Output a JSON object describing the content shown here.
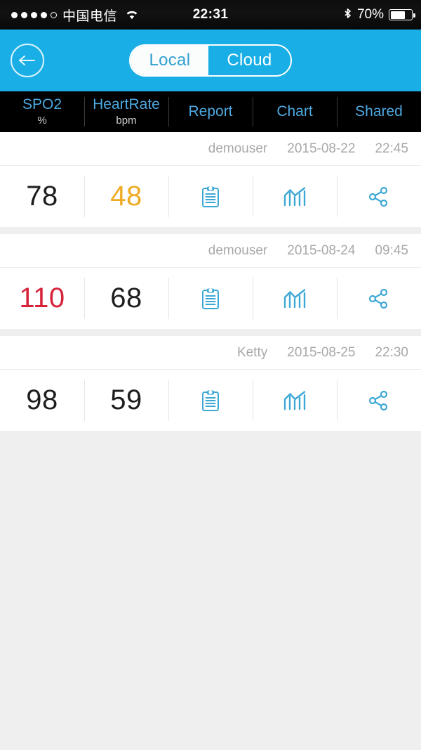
{
  "status_bar": {
    "signal_dots_filled": 4,
    "signal_dots_total": 5,
    "carrier": "中国电信",
    "wifi_icon": "wifi-icon",
    "time": "22:31",
    "bluetooth_icon": "bluetooth-icon",
    "battery_percent": "70%",
    "battery_level": 70
  },
  "nav_bar": {
    "back_icon": "back-arrow-icon",
    "segments": [
      {
        "label": "Local",
        "selected": true
      },
      {
        "label": "Cloud",
        "selected": false
      }
    ]
  },
  "columns": [
    {
      "title": "SPO2",
      "unit": "%"
    },
    {
      "title": "HeartRate",
      "unit": "bpm"
    },
    {
      "title": "Report",
      "unit": ""
    },
    {
      "title": "Chart",
      "unit": ""
    },
    {
      "title": "Shared",
      "unit": ""
    }
  ],
  "records": [
    {
      "user": "demouser",
      "date": "2015-08-22",
      "time": "22:45",
      "spo2": "78",
      "spo2_state": "normal",
      "heart_rate": "48",
      "heart_rate_state": "warn",
      "report_icon": "clipboard-report-icon",
      "chart_icon": "bar-chart-icon",
      "share_icon": "share-icon"
    },
    {
      "user": "demouser",
      "date": "2015-08-24",
      "time": "09:45",
      "spo2": "110",
      "spo2_state": "alert",
      "heart_rate": "68",
      "heart_rate_state": "normal",
      "report_icon": "clipboard-report-icon",
      "chart_icon": "bar-chart-icon",
      "share_icon": "share-icon"
    },
    {
      "user": "Ketty",
      "date": "2015-08-25",
      "time": "22:30",
      "spo2": "98",
      "spo2_state": "normal",
      "heart_rate": "59",
      "heart_rate_state": "normal",
      "report_icon": "clipboard-report-icon",
      "chart_icon": "bar-chart-icon",
      "share_icon": "share-icon"
    }
  ],
  "colors": {
    "accent_blue": "#19AFE6",
    "icon_blue": "#3ea8d4",
    "header_label_blue": "#4fa8e0",
    "warn_amber": "#eeab23",
    "alert_red": "#d6233a",
    "page_bg": "#efefef",
    "header_bg": "#000000"
  }
}
